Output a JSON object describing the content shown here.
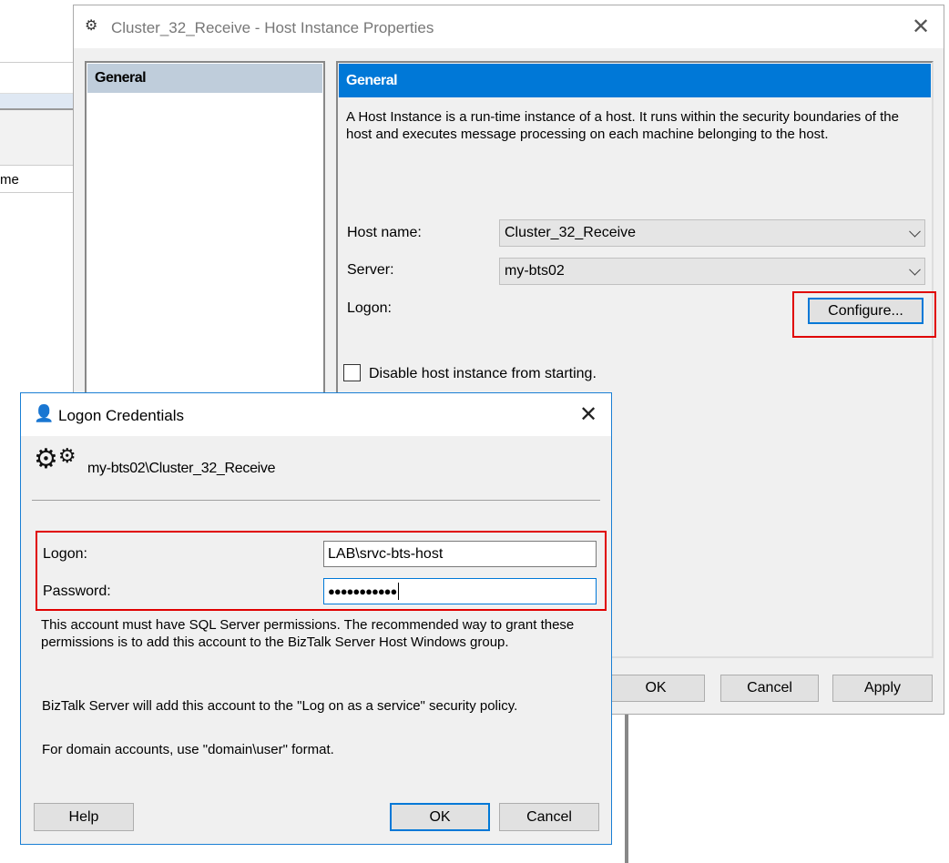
{
  "background": {
    "column_header": "me"
  },
  "properties_dialog": {
    "title": "Cluster_32_Receive - Host Instance Properties",
    "nav_items": [
      {
        "label": "General",
        "selected": true
      }
    ],
    "panel_header": "General",
    "description": "A Host Instance is a run-time instance of a host. It runs within the security boundaries of the host and executes message processing on each machine belonging to the host.",
    "host_name_label": "Host name:",
    "host_name_value": "Cluster_32_Receive",
    "server_label": "Server:",
    "server_value": "my-bts02",
    "logon_label": "Logon:",
    "configure_button": "Configure...",
    "disable_label": "Disable host instance from starting.",
    "disable_checked": false,
    "ok": "OK",
    "cancel": "Cancel",
    "apply": "Apply",
    "accent": "#0078d7",
    "highlight_color": "#e00000"
  },
  "logon_dialog": {
    "title": "Logon Credentials",
    "account": "my-bts02\\Cluster_32_Receive",
    "logon_label": "Logon:",
    "logon_value": "LAB\\srvc-bts-host",
    "password_label": "Password:",
    "password_value": "●●●●●●●●●●●",
    "note1": "This account must have SQL Server permissions. The recommended way to grant these permissions is to add this account to the BizTalk Server Host Windows group.",
    "note2": "BizTalk Server will add this account to the \"Log on as a service\" security policy.",
    "note3": "For domain accounts, use \"domain\\user\" format.",
    "help": "Help",
    "ok": "OK",
    "cancel": "Cancel"
  }
}
